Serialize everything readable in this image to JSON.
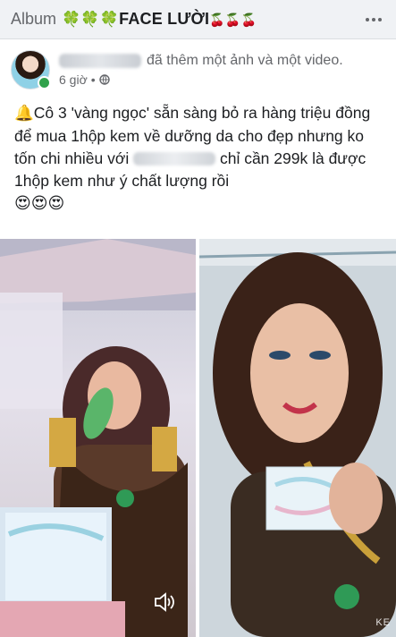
{
  "topbar": {
    "album_label": "Album",
    "title_text": "FACE LƯỜI",
    "clovers": "🍀🍀🍀",
    "cherries": "🍒🍒🍒",
    "more_icon": "more-dots-icon"
  },
  "post": {
    "action_text": "đã thêm một ảnh và một video.",
    "time": "6 giờ",
    "separator": "•",
    "audience_icon": "globe-icon",
    "body_part1": "Cô 3 'vàng ngọc' sẵn sàng bỏ ra hàng triệu đồng để mua 1hộp kem về dưỡng da cho đẹp nhưng ko tốn chi nhiều với",
    "body_part2": "chỉ cần 299k là được 1hộp kem như ý chất lượng rồi",
    "bell_emoji": "🔔",
    "heart_eyes": "😍😍😍"
  },
  "media": {
    "video_watermark": "KE",
    "sound_icon": "speaker-icon"
  }
}
